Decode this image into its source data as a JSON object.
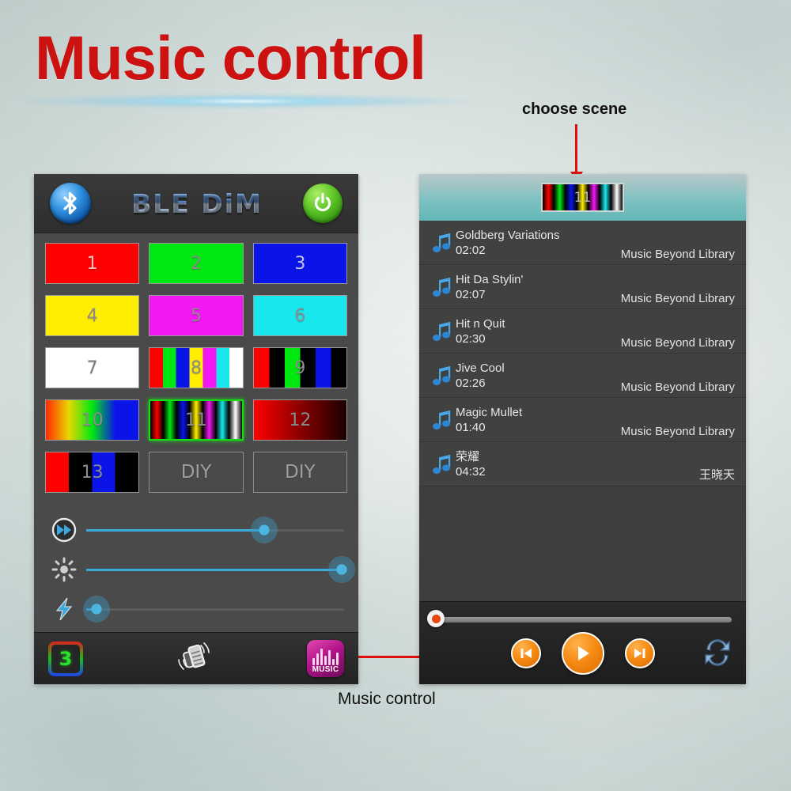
{
  "slide": {
    "title": "Music control",
    "annotations": {
      "choose_scene": "choose scene",
      "music_control": "Music control"
    },
    "accent_red": "#cc1111",
    "arrow_color": "#e01010"
  },
  "left_app": {
    "header": {
      "title": "BLE DiM",
      "bluetooth_icon": "bluetooth-icon",
      "power_icon": "power-icon"
    },
    "scene_buttons": [
      {
        "label": "1",
        "kind": "solid",
        "colors": [
          "#ff0000"
        ]
      },
      {
        "label": "2",
        "kind": "solid",
        "colors": [
          "#00e812"
        ]
      },
      {
        "label": "3",
        "kind": "solid",
        "colors": [
          "#0a14e8"
        ]
      },
      {
        "label": "4",
        "kind": "solid",
        "colors": [
          "#ffee00"
        ]
      },
      {
        "label": "5",
        "kind": "solid",
        "colors": [
          "#f318f3"
        ]
      },
      {
        "label": "6",
        "kind": "solid",
        "colors": [
          "#18e8ee"
        ]
      },
      {
        "label": "7",
        "kind": "solid",
        "colors": [
          "#ffffff"
        ]
      },
      {
        "label": "8",
        "kind": "bands",
        "colors": [
          "#ff0000",
          "#00e812",
          "#0a14e8",
          "#ffee00",
          "#f318f3",
          "#18e8ee",
          "#ffffff"
        ]
      },
      {
        "label": "9",
        "kind": "bands",
        "colors": [
          "#ff0000",
          "#000000",
          "#00e812",
          "#000000",
          "#0a14e8",
          "#000000"
        ]
      },
      {
        "label": "10",
        "kind": "gradient",
        "colors": [
          "#ff2a00",
          "#e8d800",
          "#00e812",
          "#0a14e8",
          "#0a14e8"
        ]
      },
      {
        "label": "11",
        "kind": "softbands",
        "selected": true,
        "colors": [
          "#ff0000",
          "#00e812",
          "#0a14e8",
          "#ffee00",
          "#f318f3",
          "#18e8ee",
          "#ffffff"
        ]
      },
      {
        "label": "12",
        "kind": "gradient",
        "colors": [
          "#ff0000",
          "#8a0000",
          "#1a0000"
        ]
      },
      {
        "label": "13",
        "kind": "bands",
        "colors": [
          "#ff0000",
          "#000000",
          "#0a14e8",
          "#000000"
        ]
      },
      {
        "label": "DIY",
        "kind": "diy",
        "colors": []
      },
      {
        "label": "DIY",
        "kind": "diy",
        "colors": []
      }
    ],
    "sliders": [
      {
        "name": "speed",
        "icon": "fast-forward-icon",
        "value": 69
      },
      {
        "name": "brightness",
        "icon": "brightness-icon",
        "value": 99
      },
      {
        "name": "flash",
        "icon": "lightning-icon",
        "value": 4
      }
    ],
    "bottom_nav": {
      "scene_badge": "3",
      "shake_icon": "shake-phone-icon",
      "music_label": "MUSIC",
      "music_icon": "music-equalizer-icon"
    }
  },
  "music_app": {
    "scene_selector": {
      "label": "11",
      "icon": "color-bands-icon"
    },
    "tracks": [
      {
        "name": "Goldberg Variations",
        "time": "02:02",
        "album": "Music Beyond Library"
      },
      {
        "name": "Hit Da Stylin'",
        "time": "02:07",
        "album": "Music Beyond Library"
      },
      {
        "name": "Hit n Quit",
        "time": "02:30",
        "album": "Music Beyond Library"
      },
      {
        "name": "Jive Cool",
        "time": "02:26",
        "album": "Music Beyond Library"
      },
      {
        "name": "Magic Mullet",
        "time": "01:40",
        "album": "Music Beyond Library"
      },
      {
        "name": "荣耀",
        "time": "04:32",
        "album": "王晓天"
      }
    ],
    "player": {
      "progress_percent": 0,
      "previous_icon": "previous-track-icon",
      "play_icon": "play-icon",
      "next_icon": "next-track-icon",
      "repeat_icon": "repeat-icon",
      "accent": "#f58a12"
    }
  }
}
